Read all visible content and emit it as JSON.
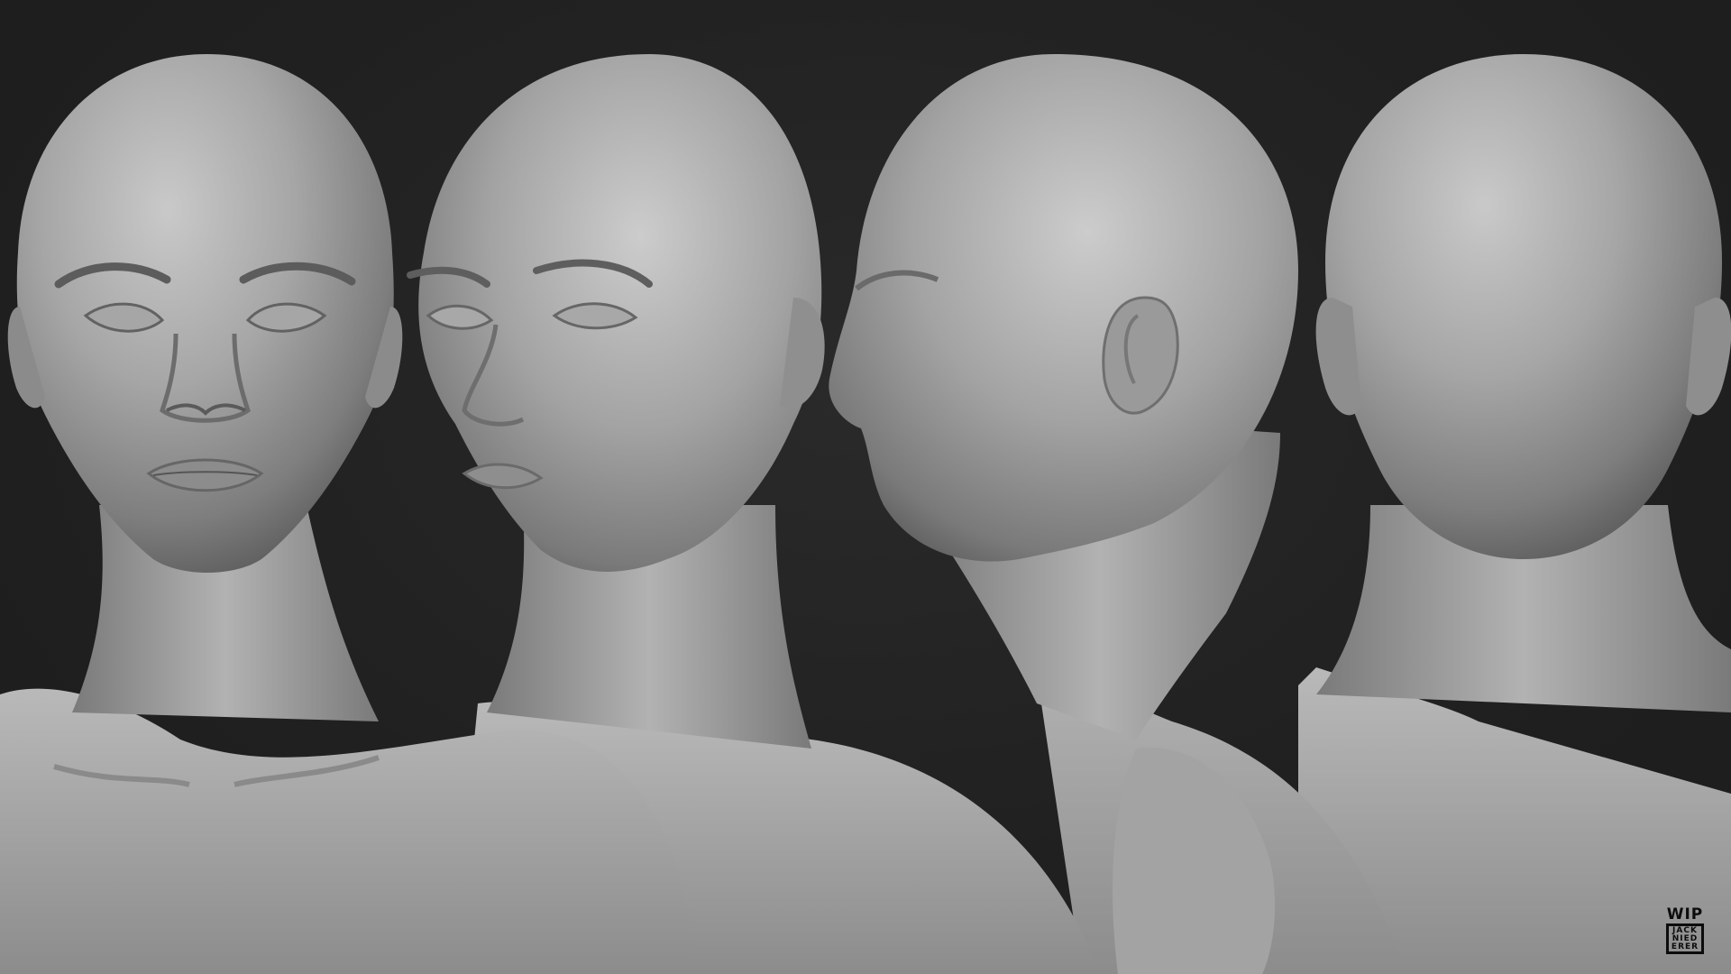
{
  "background_color": "#222222",
  "clay_color": "#9a9a9a",
  "views": [
    {
      "name": "front"
    },
    {
      "name": "three-quarter"
    },
    {
      "name": "profile"
    },
    {
      "name": "back"
    }
  ],
  "watermark": {
    "top": "WIP",
    "lines": [
      "JACK",
      "NIED",
      "ERER"
    ]
  }
}
